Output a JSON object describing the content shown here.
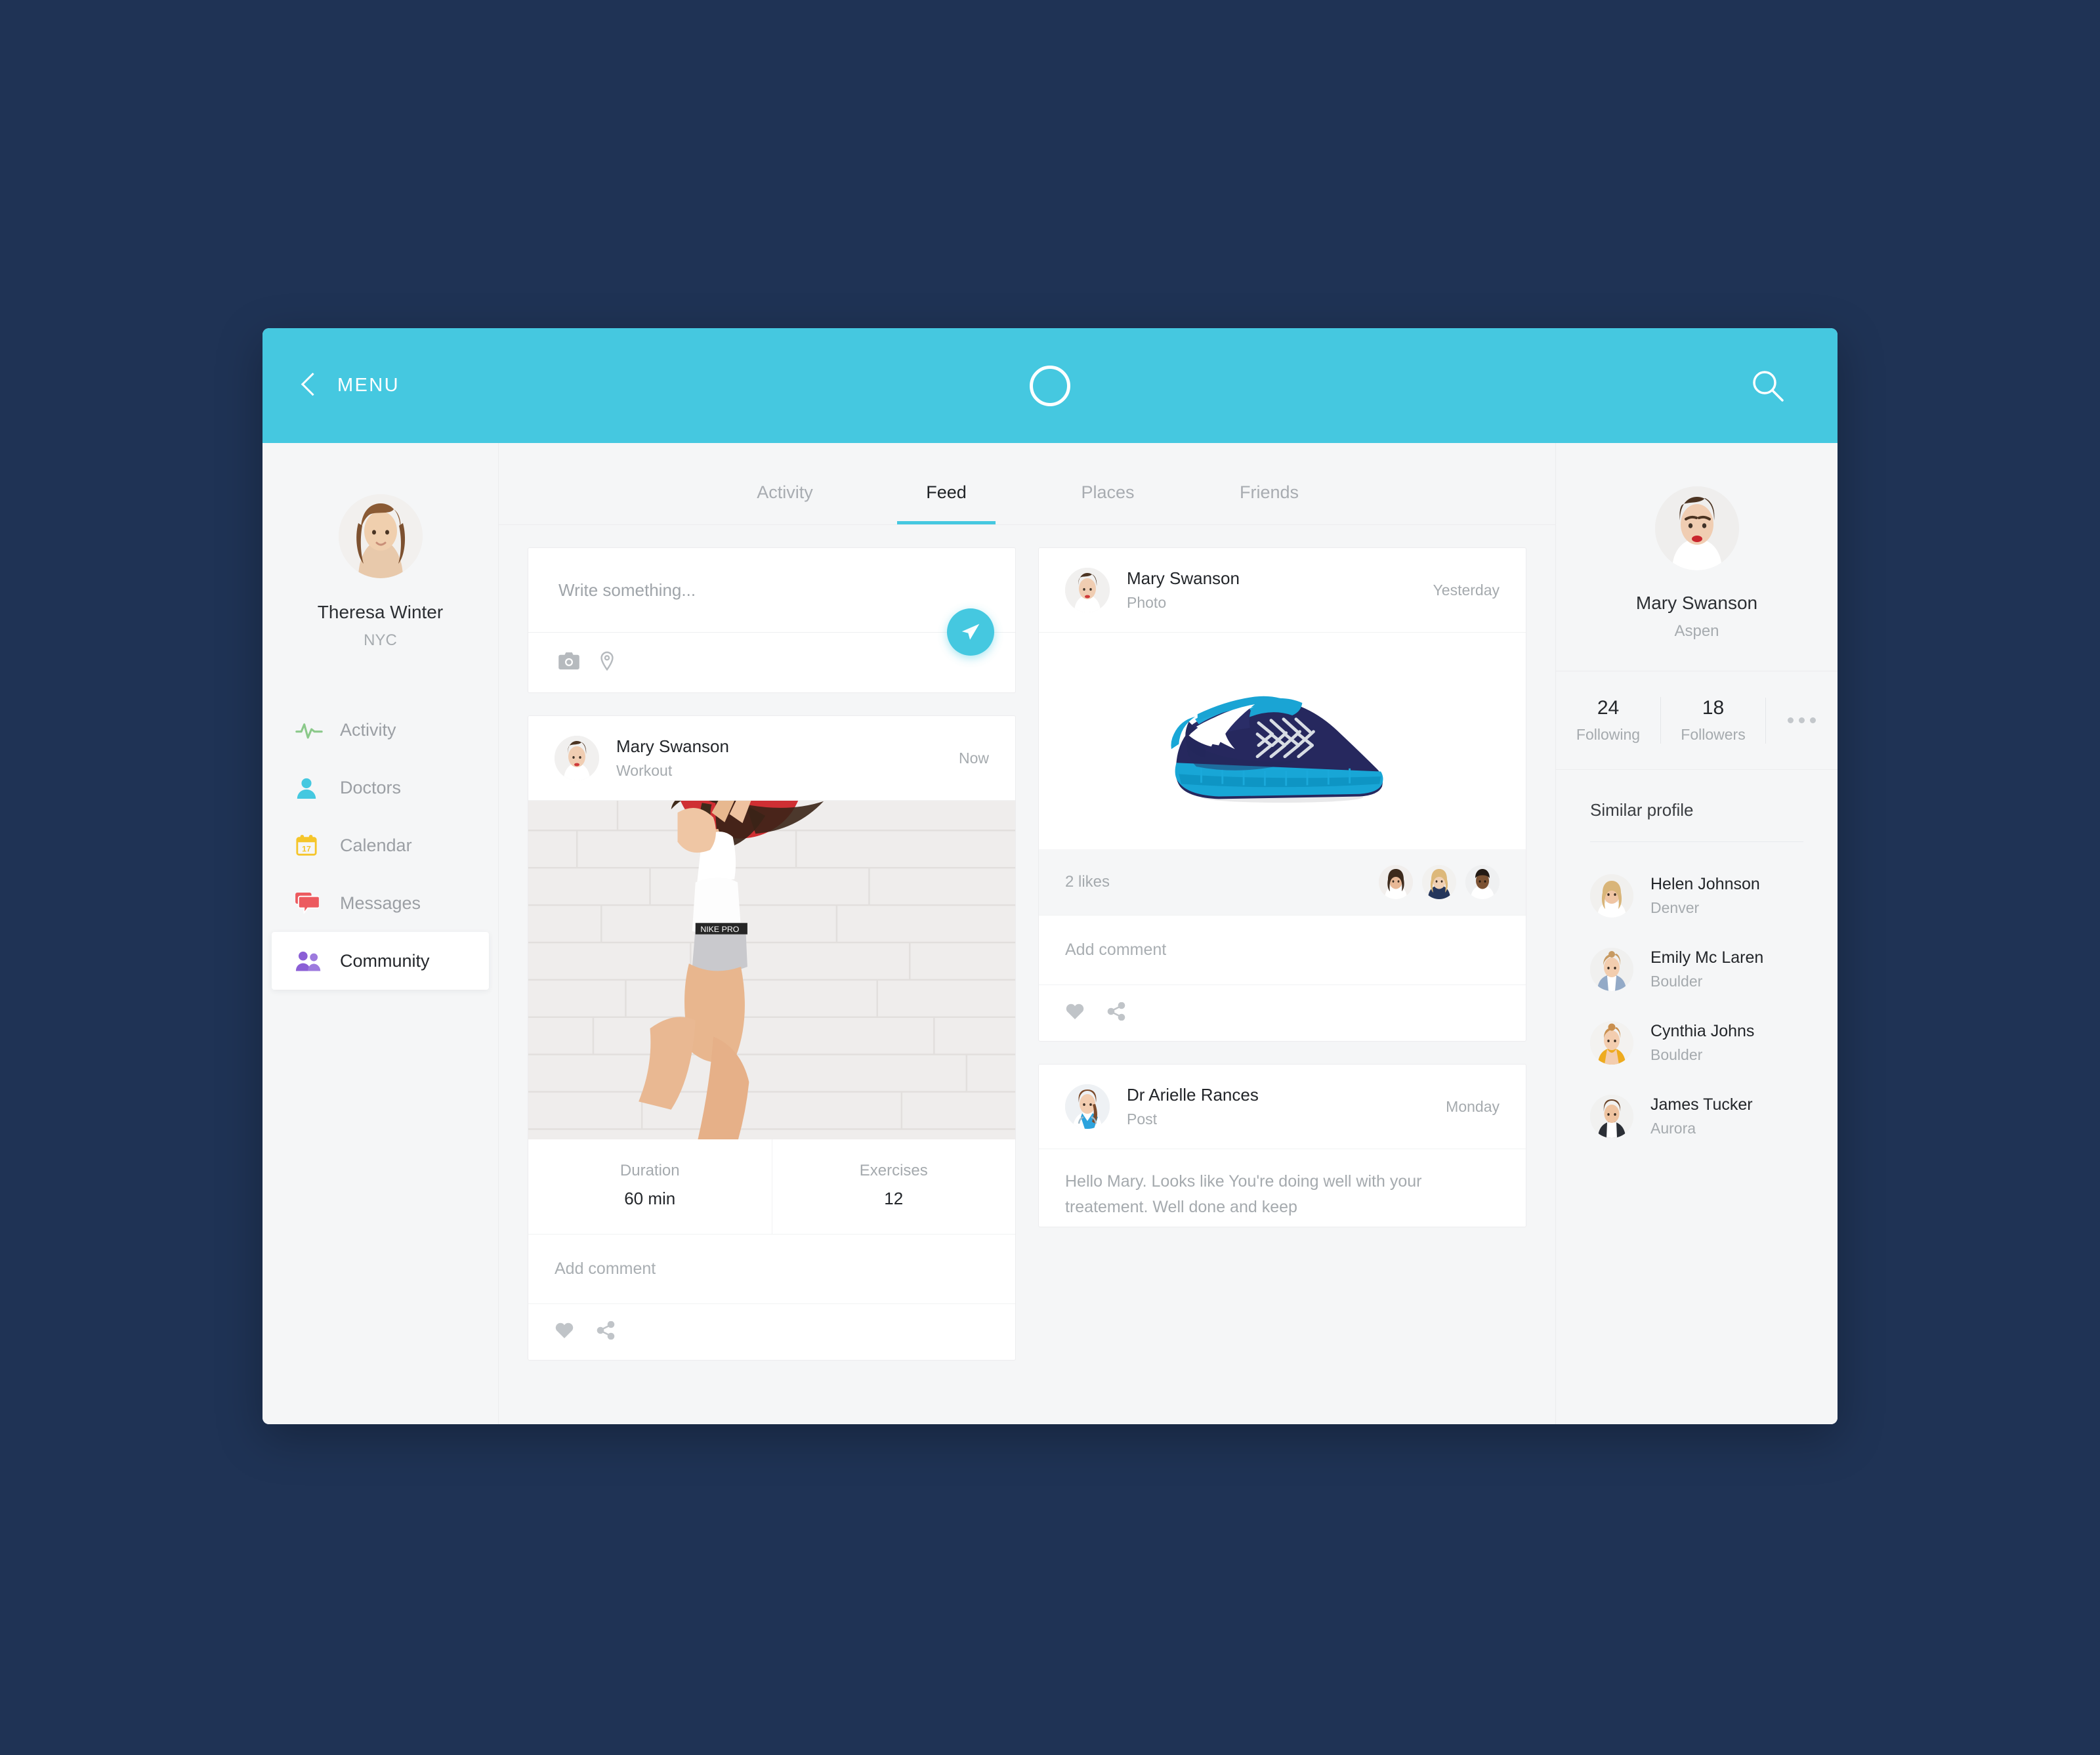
{
  "header": {
    "back_icon": "chevron-left-icon",
    "menu_label": "MENU",
    "logo_icon": "ring-logo-icon",
    "search_icon": "search-icon"
  },
  "theme": {
    "accent": "#45c8e0",
    "page_background": "#1f3355",
    "surface": "#ffffff",
    "canvas": "#f5f6f7"
  },
  "sidebar": {
    "profile": {
      "name": "Theresa Winter",
      "location": "NYC",
      "avatar": "avatar-theresa"
    },
    "items": [
      {
        "label": "Activity",
        "icon": "pulse-icon",
        "color": "#8bc98a",
        "active": false
      },
      {
        "label": "Doctors",
        "icon": "person-icon",
        "color": "#45c8e0",
        "active": false
      },
      {
        "label": "Calendar",
        "icon": "calendar-icon",
        "color": "#f5c52a",
        "active": false,
        "day": "17"
      },
      {
        "label": "Messages",
        "icon": "chat-icon",
        "color": "#ec5a5f",
        "active": false
      },
      {
        "label": "Community",
        "icon": "people-icon",
        "color": "#8b5fd6",
        "active": true
      }
    ]
  },
  "tabs": [
    {
      "label": "Activity",
      "active": false
    },
    {
      "label": "Feed",
      "active": true
    },
    {
      "label": "Places",
      "active": false
    },
    {
      "label": "Friends",
      "active": false
    }
  ],
  "compose": {
    "placeholder": "Write something...",
    "camera_icon": "camera-icon",
    "location_icon": "map-pin-icon",
    "send_icon": "send-paper-plane-icon"
  },
  "feed": {
    "workout_post": {
      "author": "Mary Swanson",
      "type": "Workout",
      "time": "Now",
      "avatar": "avatar-mary",
      "image": "weightlifting-photo",
      "stats": [
        {
          "label": "Duration",
          "value": "60 min"
        },
        {
          "label": "Exercises",
          "value": "12"
        }
      ],
      "comment_placeholder": "Add comment",
      "like_icon": "heart-icon",
      "share_icon": "share-icon"
    },
    "photo_post": {
      "author": "Mary Swanson",
      "type": "Photo",
      "time": "Yesterday",
      "avatar": "avatar-mary",
      "image": "running-shoe-photo",
      "likes_text": "2 likes",
      "liker_avatars": [
        "liker-1",
        "liker-2",
        "liker-3"
      ],
      "comment_placeholder": "Add comment",
      "like_icon": "heart-icon",
      "share_icon": "share-icon"
    },
    "doctor_post": {
      "author": "Dr Arielle Rances",
      "type": "Post",
      "time": "Monday",
      "avatar": "avatar-doctor",
      "body": "Hello Mary. Looks like You're doing well with your treatement. Well done and keep"
    }
  },
  "right_panel": {
    "profile": {
      "name": "Mary Swanson",
      "location": "Aspen",
      "avatar": "avatar-mary"
    },
    "stats": [
      {
        "value": "24",
        "label": "Following"
      },
      {
        "value": "18",
        "label": "Followers"
      }
    ],
    "more_icon": "ellipsis-icon",
    "similar_title": "Similar profile",
    "similar_profiles": [
      {
        "name": "Helen Johnson",
        "city": "Denver",
        "avatar": "avatar-helen"
      },
      {
        "name": "Emily Mc Laren",
        "city": "Boulder",
        "avatar": "avatar-emily"
      },
      {
        "name": "Cynthia Johns",
        "city": "Boulder",
        "avatar": "avatar-cynthia"
      },
      {
        "name": "James Tucker",
        "city": "Aurora",
        "avatar": "avatar-james"
      }
    ]
  }
}
